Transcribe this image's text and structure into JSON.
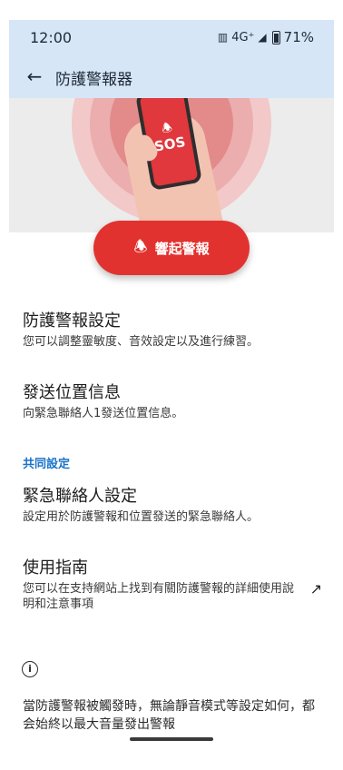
{
  "status_bar": {
    "time": "12:00",
    "network": "4G⁺",
    "battery": "71%"
  },
  "app_bar": {
    "back_icon": "arrow-left-icon",
    "title": "防護警報器"
  },
  "hero": {
    "phone_label": "SOS"
  },
  "alarm_button": {
    "icon": "siren-icon",
    "label": "響起警報"
  },
  "items": [
    {
      "title": "防護警報設定",
      "subtitle": "您可以調整靈敏度、音效設定以及進行練習。"
    },
    {
      "title": "發送位置信息",
      "subtitle": "向緊急聯絡人1發送位置信息。"
    }
  ],
  "section_header": "共同設定",
  "common_items": [
    {
      "title": "緊急聯絡人設定",
      "subtitle": "設定用於防護警報和位置發送的緊急聯絡人。"
    },
    {
      "title": "使用指南",
      "subtitle": "您可以在支持網站上找到有關防護警報的詳細使用說明和注意事項",
      "icon": "open-external-icon"
    }
  ],
  "info": {
    "icon": "info-icon",
    "text": "當防護警報被觸發時，無論靜音模式等設定如何，都会始終以最大音量發出警報"
  },
  "colors": {
    "app_bar_bg": "#d6e6f7",
    "alarm_red": "#e2322f",
    "section_blue": "#1a73c8"
  }
}
